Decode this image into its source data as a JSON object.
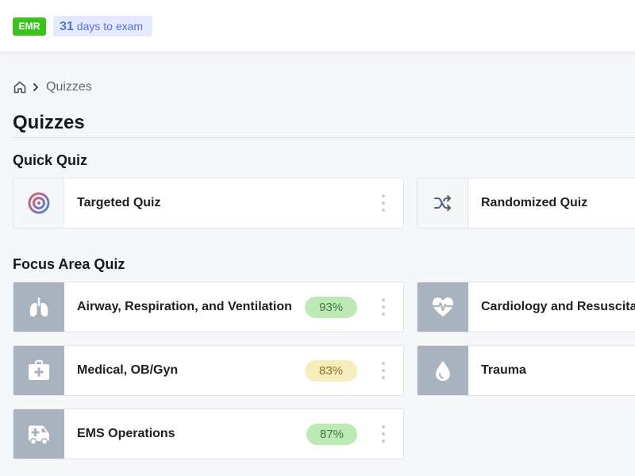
{
  "header": {
    "level_badge": "EMR",
    "exam_days_number": "31",
    "exam_days_text": "days to exam"
  },
  "breadcrumb": {
    "home_icon": "home-icon",
    "current": "Quizzes"
  },
  "page": {
    "title": "Quizzes"
  },
  "quick_quiz": {
    "title": "Quick Quiz",
    "items": [
      {
        "label": "Targeted Quiz",
        "icon": "target-icon"
      },
      {
        "label": "Randomized Quiz",
        "icon": "shuffle-icon"
      }
    ]
  },
  "focus_area": {
    "title": "Focus Area Quiz",
    "items": [
      {
        "label": "Airway, Respiration, and Ventilation",
        "score": "93%",
        "icon": "lungs-icon",
        "status": "green"
      },
      {
        "label": "Cardiology and Resuscitat",
        "icon": "heartbeat-icon"
      },
      {
        "label": "Medical, OB/Gyn",
        "score": "83%",
        "icon": "medical-kit-icon",
        "status": "yellow"
      },
      {
        "label": "Trauma",
        "icon": "blood-drop-icon"
      },
      {
        "label": "EMS Operations",
        "score": "87%",
        "icon": "ambulance-icon",
        "status": "green"
      }
    ]
  },
  "colors": {
    "badge_green": "#3cc21e",
    "exam_chip_bg": "#e4eaff",
    "exam_chip_text": "#5470e6",
    "score_green_bg": "#bde9b6",
    "score_yellow_bg": "#f6edbd",
    "icon_tile_gray": "#a9b3bf"
  }
}
